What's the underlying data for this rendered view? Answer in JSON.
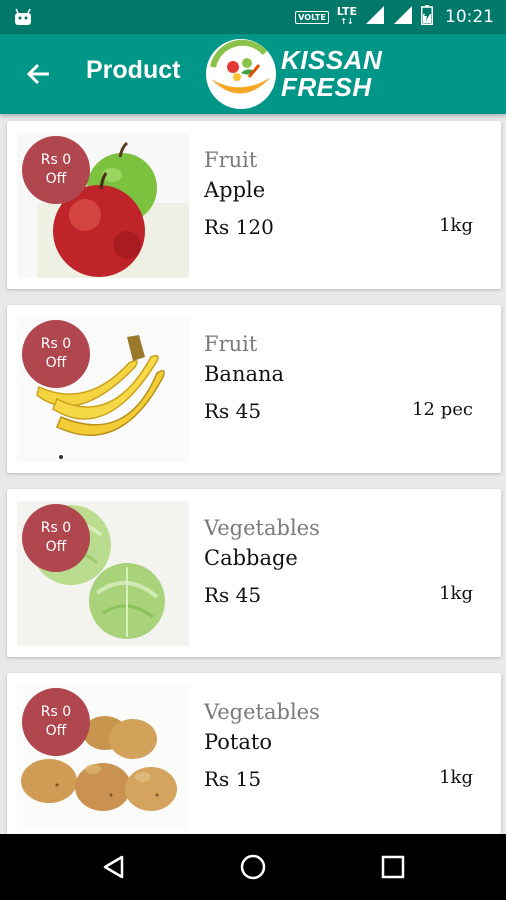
{
  "status_bar": {
    "volte": "VOLTE",
    "network": "LTE",
    "time": "10:21"
  },
  "toolbar": {
    "title": "Product",
    "brand_line1": "KISSAN",
    "brand_line2": "FRESH"
  },
  "products": [
    {
      "badge_line1": "Rs 0",
      "badge_line2": "Off",
      "category": "Fruit",
      "name": "Apple",
      "price": "Rs 120",
      "quantity": "1kg"
    },
    {
      "badge_line1": "Rs 0",
      "badge_line2": "Off",
      "category": "Fruit",
      "name": "Banana",
      "price": "Rs 45",
      "quantity": "12 pec"
    },
    {
      "badge_line1": "Rs 0",
      "badge_line2": "Off",
      "category": "Vegetables",
      "name": "Cabbage",
      "price": "Rs 45",
      "quantity": "1kg"
    },
    {
      "badge_line1": "Rs 0",
      "badge_line2": "Off",
      "category": "Vegetables",
      "name": "Potato",
      "price": "Rs 15",
      "quantity": "1kg"
    }
  ],
  "colors": {
    "status_bar": "#00796b",
    "toolbar": "#009688",
    "badge": "#b0464e"
  },
  "icons": {
    "back": "arrow-back-icon",
    "nav_back": "triangle-back-icon",
    "nav_home": "circle-home-icon",
    "nav_recents": "square-recents-icon"
  }
}
